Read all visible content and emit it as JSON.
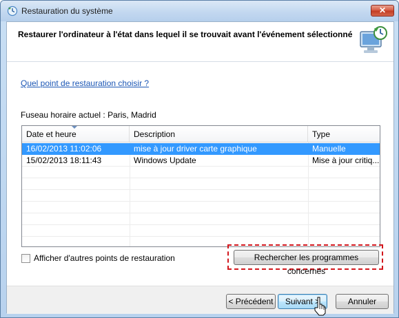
{
  "window": {
    "title": "Restauration du système"
  },
  "header": {
    "text": "Restaurer l'ordinateur à l'état dans lequel il se trouvait avant l'événement sélectionné"
  },
  "help_link": "Quel point de restauration choisir ?",
  "timezone": "Fuseau horaire actuel : Paris, Madrid",
  "table": {
    "columns": [
      "Date et heure",
      "Description",
      "Type"
    ],
    "rows": [
      {
        "date": "16/02/2013 11:02:06",
        "description": "mise à jour driver carte graphique",
        "type": "Manuelle",
        "selected": true
      },
      {
        "date": "15/02/2013 18:11:43",
        "description": "Windows Update",
        "type": "Mise à jour critiq...",
        "selected": false
      }
    ]
  },
  "show_more_checkbox": {
    "label": "Afficher d'autres points de restauration",
    "checked": false
  },
  "buttons": {
    "scan": "Rechercher les programmes concernés",
    "back": "< Précédent",
    "next": "Suivant >",
    "cancel": "Annuler"
  },
  "icons": {
    "title": "system-restore-icon",
    "header": "system-restore-computer-icon",
    "close": "close-icon",
    "cursor": "mouse-pointer-icon"
  },
  "colors": {
    "selection": "#3399ff",
    "highlight_box": "#d2161c",
    "link": "#1c57b5"
  }
}
